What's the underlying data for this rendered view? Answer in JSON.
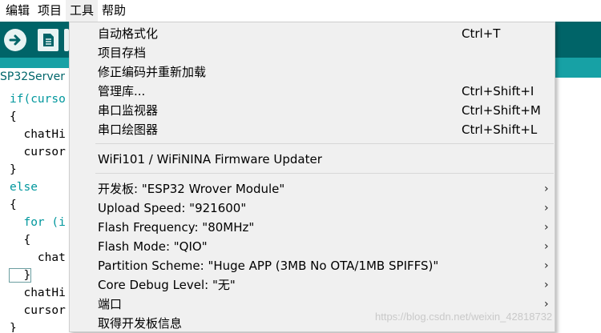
{
  "menubar": {
    "items": [
      {
        "label": "编辑"
      },
      {
        "label": "项目"
      },
      {
        "label": "工具"
      },
      {
        "label": "帮助"
      }
    ]
  },
  "editor": {
    "tab_label": "SP32Server",
    "code_lines": [
      "if(curso",
      "{",
      "  chatHi",
      "  cursor",
      "}",
      "else",
      "{",
      "  for (i",
      "  {",
      "    chat",
      "  }",
      "  chatHi",
      "  cursor",
      "}"
    ]
  },
  "tools_menu": {
    "items": [
      {
        "label": "自动格式化",
        "shortcut": "Ctrl+T",
        "submenu": false
      },
      {
        "label": "项目存档",
        "shortcut": "",
        "submenu": false
      },
      {
        "label": "修正编码并重新加载",
        "shortcut": "",
        "submenu": false
      },
      {
        "label": "管理库...",
        "shortcut": "Ctrl+Shift+I",
        "submenu": false
      },
      {
        "label": "串口监视器",
        "shortcut": "Ctrl+Shift+M",
        "submenu": false
      },
      {
        "label": "串口绘图器",
        "shortcut": "Ctrl+Shift+L",
        "submenu": false
      },
      {
        "label": "WiFi101 / WiFiNINA Firmware Updater",
        "shortcut": "",
        "submenu": false
      },
      {
        "label": "开发板: \"ESP32 Wrover Module\"",
        "shortcut": "",
        "submenu": true
      },
      {
        "label": "Upload Speed: \"921600\"",
        "shortcut": "",
        "submenu": true
      },
      {
        "label": "Flash Frequency: \"80MHz\"",
        "shortcut": "",
        "submenu": true
      },
      {
        "label": "Flash Mode: \"QIO\"",
        "shortcut": "",
        "submenu": true
      },
      {
        "label": "Partition Scheme: \"Huge APP (3MB No OTA/1MB SPIFFS)\"",
        "shortcut": "",
        "submenu": true
      },
      {
        "label": "Core Debug Level: \"无\"",
        "shortcut": "",
        "submenu": true
      },
      {
        "label": "端口",
        "shortcut": "",
        "submenu": true
      },
      {
        "label": "取得开发板信息",
        "shortcut": "",
        "submenu": false
      }
    ],
    "submenu_arrow": "›"
  },
  "watermark": "https://blog.csdn.net/weixin_42818732",
  "colors": {
    "toolbar": "#006468",
    "tabstrip": "#17a1a5",
    "menu_bg": "#f0f0f0",
    "keyword": "#00979d"
  }
}
